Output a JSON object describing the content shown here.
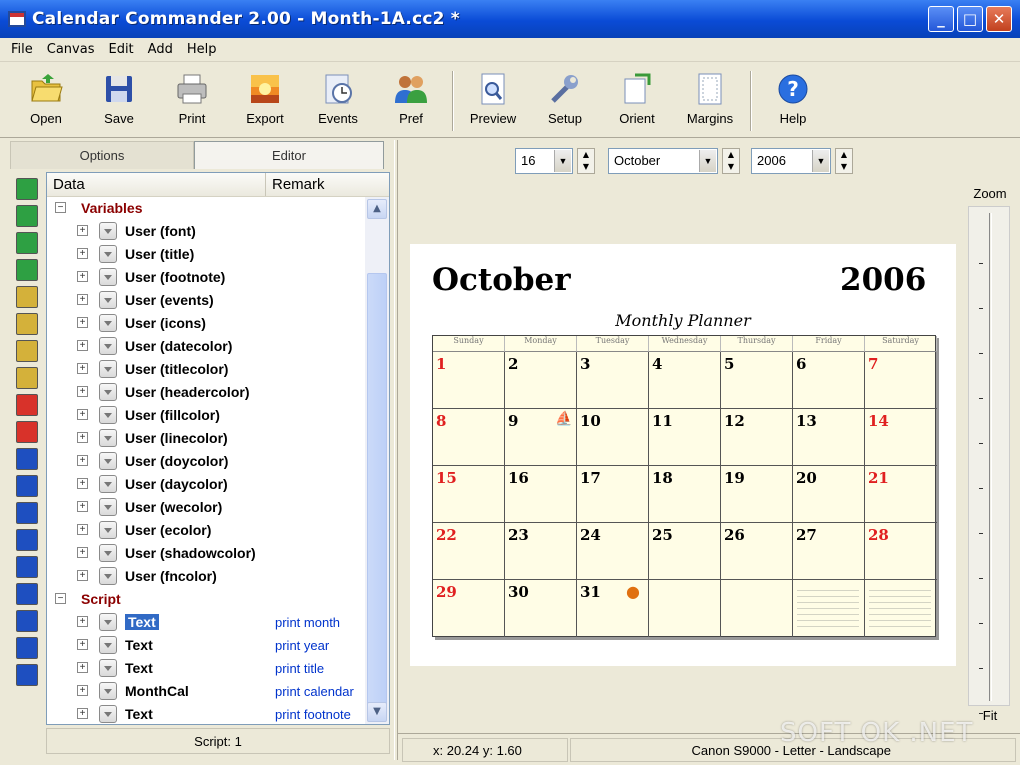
{
  "window": {
    "title": "Calendar Commander 2.00 - Month-1A.cc2 *",
    "min": "_",
    "max": "□",
    "close": "✕"
  },
  "menu": [
    "File",
    "Canvas",
    "Edit",
    "Add",
    "Help"
  ],
  "toolbar": [
    {
      "label": "Open",
      "icon": "folder-open-icon"
    },
    {
      "label": "Save",
      "icon": "floppy-disk-icon"
    },
    {
      "label": "Print",
      "icon": "printer-icon"
    },
    {
      "label": "Export",
      "icon": "export-image-icon"
    },
    {
      "label": "Events",
      "icon": "events-clock-icon"
    },
    {
      "label": "Pref",
      "icon": "people-icon"
    },
    {
      "label": "Preview",
      "icon": "preview-magnifier-icon"
    },
    {
      "label": "Setup",
      "icon": "wrench-icon"
    },
    {
      "label": "Orient",
      "icon": "orient-page-icon"
    },
    {
      "label": "Margins",
      "icon": "margins-page-icon"
    },
    {
      "label": "Help",
      "icon": "help-question-icon"
    }
  ],
  "tabs": {
    "options": "Options",
    "editor": "Editor"
  },
  "tree": {
    "col_data": "Data",
    "col_remark": "Remark",
    "section_variables": "Variables",
    "variables": [
      "User (font)",
      "User (title)",
      "User (footnote)",
      "User (events)",
      "User (icons)",
      "User (datecolor)",
      "User (titlecolor)",
      "User (headercolor)",
      "User (fillcolor)",
      "User (linecolor)",
      "User (doycolor)",
      "User (daycolor)",
      "User (wecolor)",
      "User (ecolor)",
      "User (shadowcolor)",
      "User (fncolor)"
    ],
    "section_script": "Script",
    "script": [
      {
        "name": "Text",
        "remark": "print month"
      },
      {
        "name": "Text",
        "remark": "print year"
      },
      {
        "name": "Text",
        "remark": "print title"
      },
      {
        "name": "MonthCal",
        "remark": "print calendar"
      },
      {
        "name": "Text",
        "remark": "print footnote"
      }
    ]
  },
  "left_status": "Script: 1",
  "date_controls": {
    "day": "16",
    "month": "October",
    "year": "2006"
  },
  "calendar": {
    "month": "October",
    "year": "2006",
    "title": "Monthly Planner",
    "weekdays": [
      "Sunday",
      "Monday",
      "Tuesday",
      "Wednesday",
      "Thursday",
      "Friday",
      "Saturday"
    ],
    "weeks": [
      [
        "1",
        "2",
        "3",
        "4",
        "5",
        "6",
        "7"
      ],
      [
        "8",
        "9",
        "10",
        "11",
        "12",
        "13",
        "14"
      ],
      [
        "15",
        "16",
        "17",
        "18",
        "19",
        "20",
        "21"
      ],
      [
        "22",
        "23",
        "24",
        "25",
        "26",
        "27",
        "28"
      ],
      [
        "29",
        "30",
        "31",
        "",
        "",
        "",
        ""
      ]
    ],
    "weekend_color": "#e02020"
  },
  "zoom": {
    "label": "Zoom",
    "fit": "Fit"
  },
  "status": {
    "coords": "x: 20.24  y: 1.60",
    "printer": "Canon S9000 - Letter - Landscape"
  },
  "watermark": "SOFT OK .NET"
}
